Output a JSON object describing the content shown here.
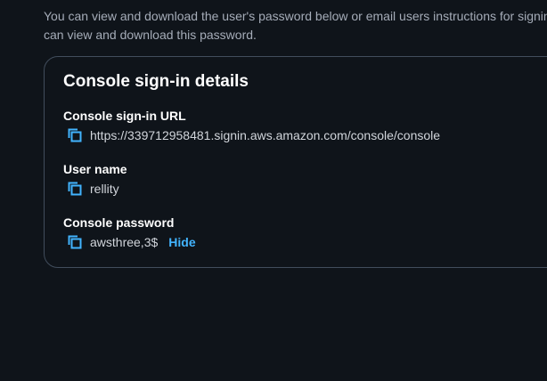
{
  "intro": {
    "line1": "You can view and download the user's password below or email users instructions for signing in",
    "line2": "can view and download this password."
  },
  "card": {
    "title": "Console sign-in details",
    "url": {
      "label": "Console sign-in URL",
      "value": "https://339712958481.signin.aws.amazon.com/console/console"
    },
    "username": {
      "label": "User name",
      "value": "rellity"
    },
    "password": {
      "label": "Console password",
      "value": "awsthree,3$",
      "toggle_label": "Hide"
    }
  },
  "colors": {
    "background": "#0f141a",
    "card_border": "#414d5c",
    "link": "#42b4ff",
    "copy_icon": "#42b4ff"
  },
  "icons": {
    "copy": "copy-icon"
  }
}
